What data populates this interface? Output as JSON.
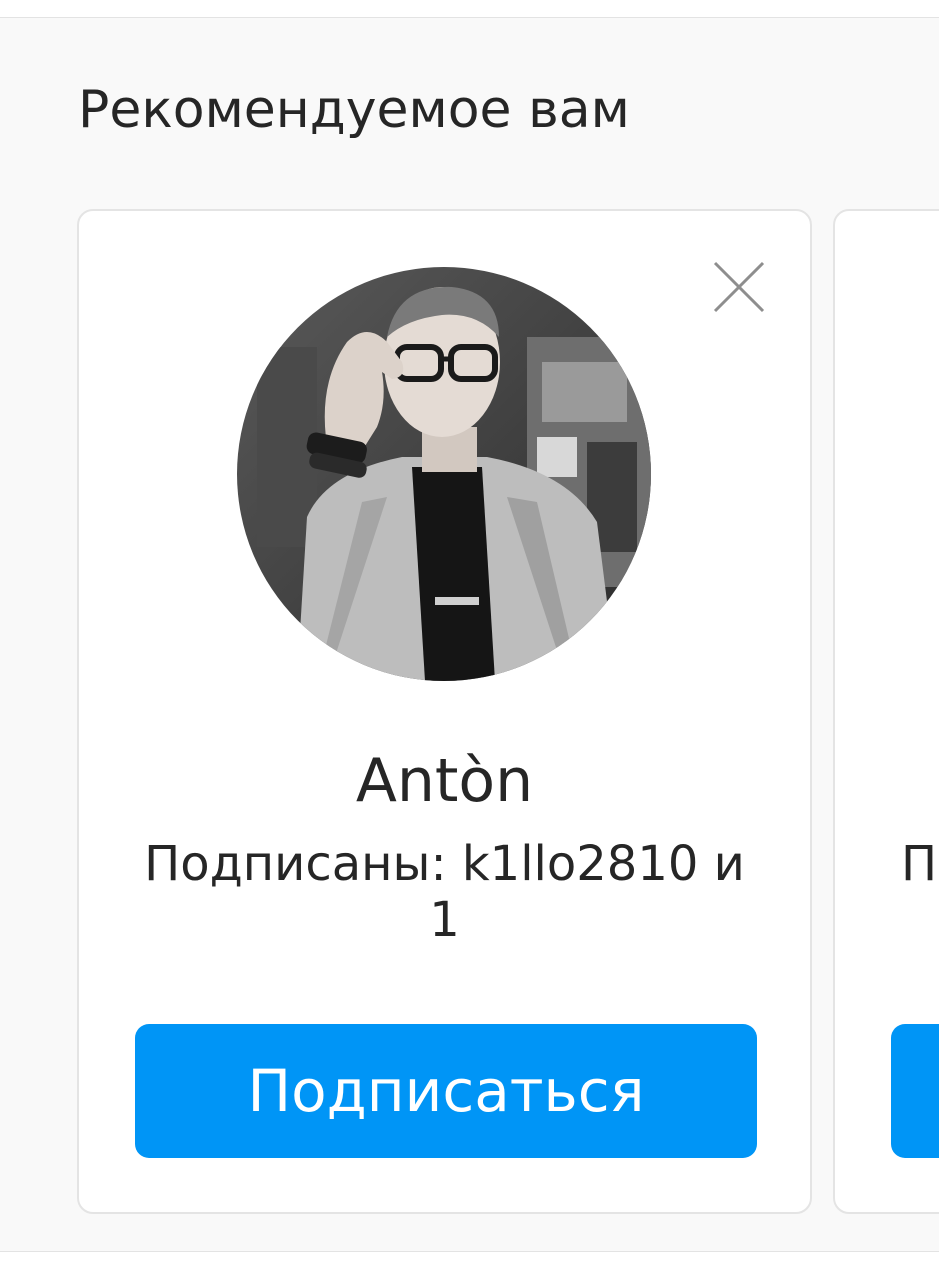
{
  "suggestions": {
    "title": "Рекомендуемое вам",
    "cards": [
      {
        "name": "Antòn",
        "subtitle": "Подписаны: k1llo2810 и 1",
        "follow_label": "Подписаться",
        "avatar_icon": "profile-photo",
        "dismiss_icon": "close-icon"
      },
      {
        "subtitle_start": "П"
      }
    ]
  },
  "colors": {
    "accent": "#0095f6",
    "text": "#262626",
    "background": "#f9f9f9",
    "card": "#ffffff"
  }
}
